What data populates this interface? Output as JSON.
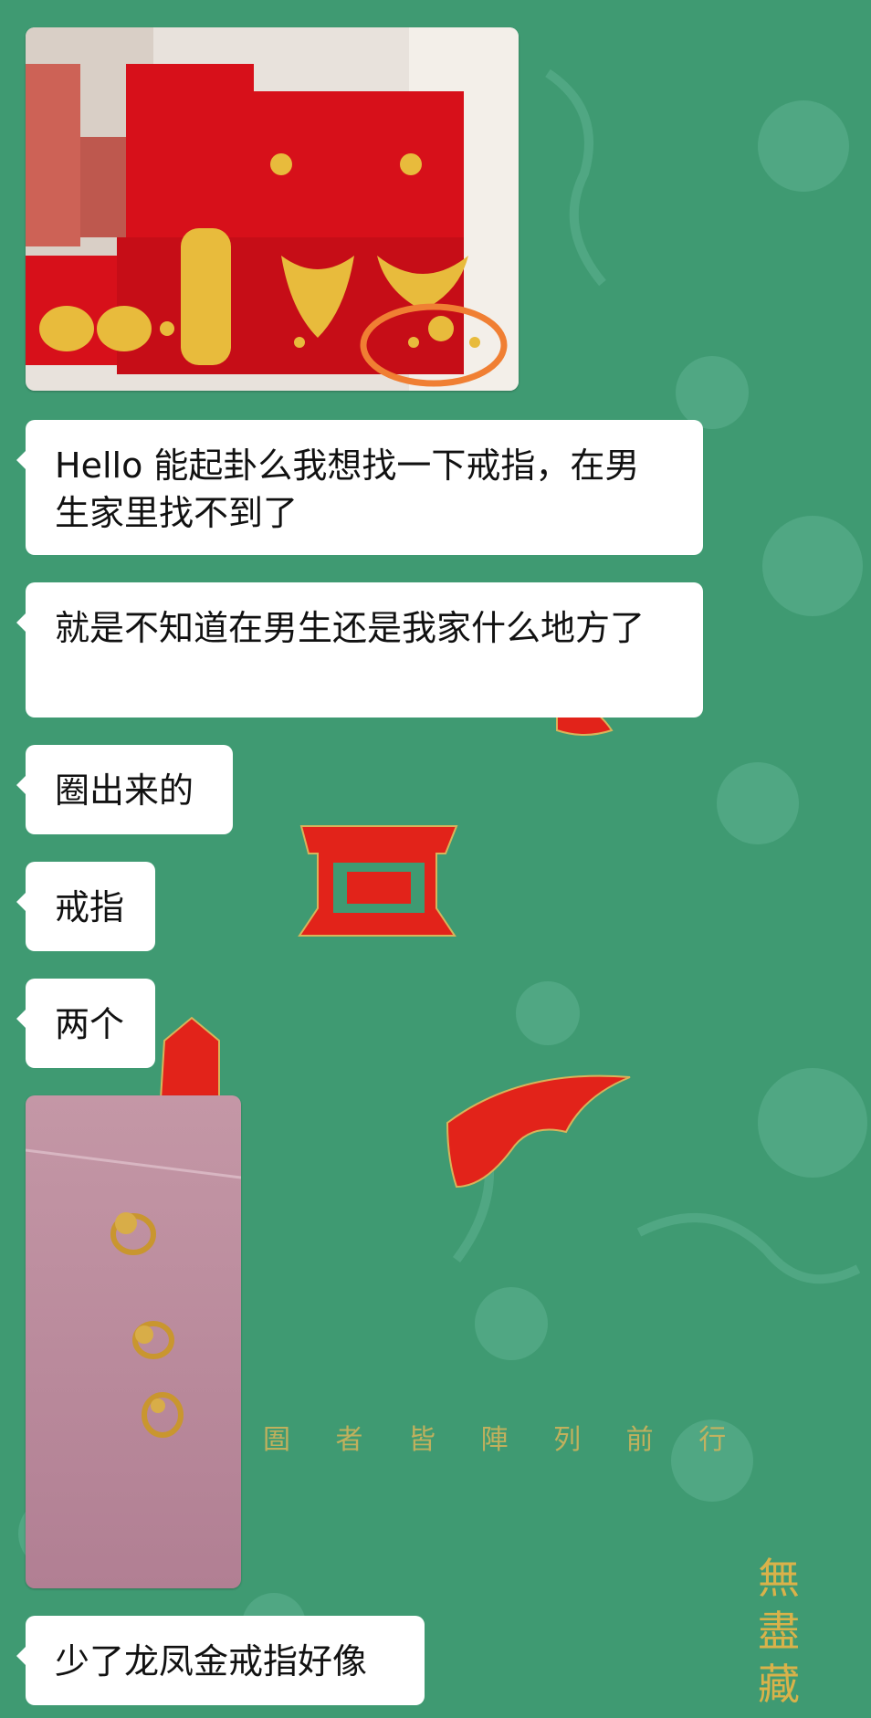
{
  "background": {
    "color": "#3f9a72",
    "accent_red": "#e2231a",
    "accent_gold": "#d7b45a",
    "poster_caption": "圄 者 皆 陣 列 前 行",
    "poster_signature": "無盡藏"
  },
  "messages": [
    {
      "type": "image",
      "description_icon": "photo-icon"
    },
    {
      "type": "text",
      "text": "Hello 能起卦么我想找一下戒指，在男生家里找不到了"
    },
    {
      "type": "text",
      "text": "就是不知道在男生还是我家什么地方了"
    },
    {
      "type": "text",
      "text": "圈出来的"
    },
    {
      "type": "text",
      "text": "戒指"
    },
    {
      "type": "text",
      "text": "两个"
    },
    {
      "type": "image",
      "description_icon": "photo-icon"
    },
    {
      "type": "text",
      "text": "少了龙凤金戒指好像"
    }
  ]
}
